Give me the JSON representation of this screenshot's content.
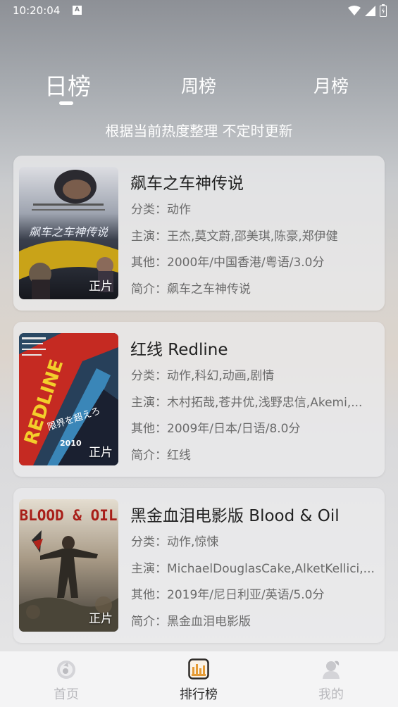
{
  "status": {
    "time": "10:20:04",
    "notif": "A"
  },
  "tabs": [
    {
      "label": "日榜",
      "active": true
    },
    {
      "label": "周榜",
      "active": false
    },
    {
      "label": "月榜",
      "active": false
    }
  ],
  "subtitle": "根据当前热度整理 不定时更新",
  "movies": [
    {
      "title": "飙车之车神传说",
      "badge": "正片",
      "genre_label": "分类：",
      "genre": "动作",
      "cast_label": "主演：",
      "cast": "王杰,莫文蔚,邵美琪,陈豪,郑伊健",
      "other_label": "其他：",
      "other": "2000年/中国香港/粤语/3.0分",
      "intro_label": "简介：",
      "intro": "飙车之车神传说"
    },
    {
      "title": "红线 Redline",
      "badge": "正片",
      "genre_label": "分类：",
      "genre": "动作,科幻,动画,剧情",
      "cast_label": "主演：",
      "cast": "木村拓哉,苍井优,浅野忠信,Akemi,...",
      "other_label": "其他：",
      "other": "2009年/日本/日语/8.0分",
      "intro_label": "简介：",
      "intro": "红线"
    },
    {
      "title": "黑金血泪电影版 Blood & Oil",
      "badge": "正片",
      "genre_label": "分类：",
      "genre": "动作,惊悚",
      "cast_label": "主演：",
      "cast": "MichaelDouglasCake,AlketKellici,...",
      "other_label": "其他：",
      "other": "2019年/尼日利亚/英语/5.0分",
      "intro_label": "简介：",
      "intro": "黑金血泪电影版"
    }
  ],
  "poster_text": {
    "p1_title": "飙车之车神传说",
    "p2_title": "REDLINE",
    "p2_sub": "限界を超えろ",
    "p2_year": "2010",
    "p3_title": "BLOOD & OIL"
  },
  "nav": [
    {
      "label": "首页",
      "icon": "home-icon",
      "active": false
    },
    {
      "label": "排行榜",
      "icon": "ranking-icon",
      "active": true
    },
    {
      "label": "我的",
      "icon": "profile-icon",
      "active": false
    }
  ],
  "colors": {
    "accent": "#e59b35",
    "nav_inactive": "#b9b9bd"
  }
}
